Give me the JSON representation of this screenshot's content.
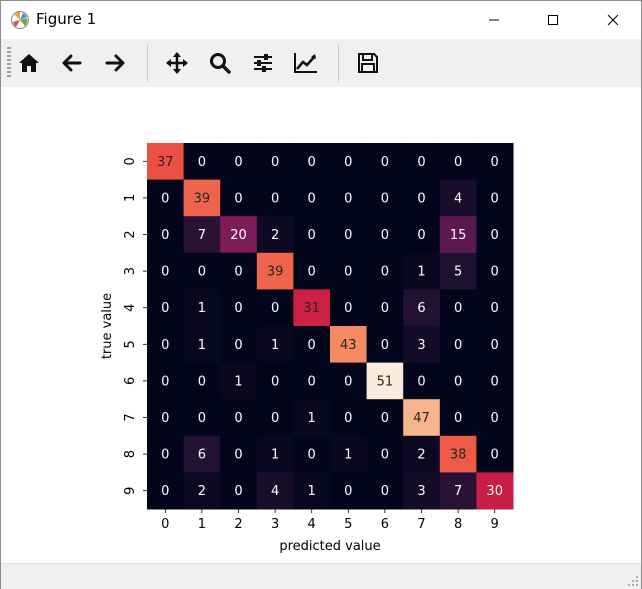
{
  "window": {
    "title": "Figure 1"
  },
  "toolbar": {
    "buttons": [
      {
        "name": "home-button",
        "icon": "home-icon"
      },
      {
        "name": "back-button",
        "icon": "arrow-left-icon"
      },
      {
        "name": "forward-button",
        "icon": "arrow-right-icon"
      },
      {
        "name": "pan-button",
        "icon": "move-icon"
      },
      {
        "name": "zoom-button",
        "icon": "magnifier-icon"
      },
      {
        "name": "configure-subplots-button",
        "icon": "sliders-icon"
      },
      {
        "name": "edit-axes-button",
        "icon": "line-chart-icon"
      },
      {
        "name": "save-button",
        "icon": "floppy-disk-icon"
      }
    ]
  },
  "chart_data": {
    "type": "heatmap",
    "xlabel": "predicted value",
    "ylabel": "true value",
    "x_categories": [
      "0",
      "1",
      "2",
      "3",
      "4",
      "5",
      "6",
      "7",
      "8",
      "9"
    ],
    "y_categories": [
      "0",
      "1",
      "2",
      "3",
      "4",
      "5",
      "6",
      "7",
      "8",
      "9"
    ],
    "values": [
      [
        37,
        0,
        0,
        0,
        0,
        0,
        0,
        0,
        0,
        0
      ],
      [
        0,
        39,
        0,
        0,
        0,
        0,
        0,
        0,
        4,
        0
      ],
      [
        0,
        7,
        20,
        2,
        0,
        0,
        0,
        0,
        15,
        0
      ],
      [
        0,
        0,
        0,
        39,
        0,
        0,
        0,
        1,
        5,
        0
      ],
      [
        0,
        1,
        0,
        0,
        31,
        0,
        0,
        6,
        0,
        0
      ],
      [
        0,
        1,
        0,
        1,
        0,
        43,
        0,
        3,
        0,
        0
      ],
      [
        0,
        0,
        1,
        0,
        0,
        0,
        51,
        0,
        0,
        0
      ],
      [
        0,
        0,
        0,
        0,
        1,
        0,
        0,
        47,
        0,
        0
      ],
      [
        0,
        6,
        0,
        1,
        0,
        1,
        0,
        2,
        38,
        0
      ],
      [
        0,
        2,
        0,
        4,
        1,
        0,
        0,
        3,
        7,
        30
      ]
    ],
    "colormap": "rocket",
    "vmin": 0,
    "vmax": 51,
    "annotations": true,
    "colorbar": false
  }
}
